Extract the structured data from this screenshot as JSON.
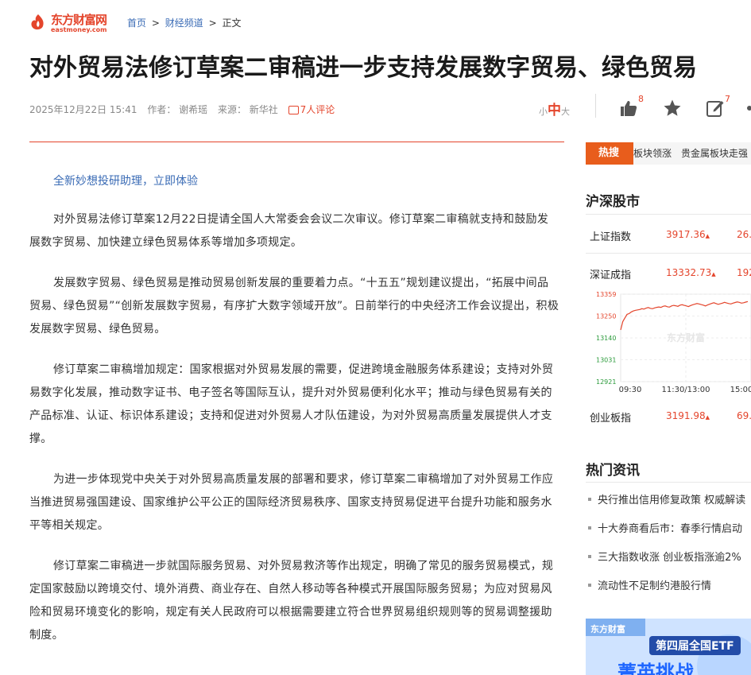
{
  "header": {
    "logo_cn": "东方财富网",
    "logo_en": "eastmoney.com",
    "breadcrumb": [
      "首页",
      "财经频道",
      "正文"
    ]
  },
  "article": {
    "title": "对外贸易法修订草案二审稿进一步支持发展数字贸易、绿色贸易",
    "date": "2025年12月22日 15:41",
    "author": "作者：  谢希瑶",
    "source": "来源：  新华社",
    "comments": "7人评论",
    "promo": "全新妙想投研助理，立即体验",
    "paragraphs": [
      "对外贸易法修订草案12月22日提请全国人大常委会会议二次审议。修订草案二审稿就支持和鼓励发展数字贸易、加快建立绿色贸易体系等增加多项规定。",
      "发展数字贸易、绿色贸易是推动贸易创新发展的重要着力点。“十五五”规划建议提出，“拓展中间品贸易、绿色贸易”“创新发展数字贸易，有序扩大数字领域开放”。日前举行的中央经济工作会议提出，积极发展数字贸易、绿色贸易。",
      "修订草案二审稿增加规定：国家根据对外贸易发展的需要，促进跨境金融服务体系建设；支持对外贸易数字化发展，推动数字证书、电子签名等国际互认，提升对外贸易便利化水平；推动与绿色贸易有关的产品标准、认证、标识体系建设；支持和促进对外贸易人才队伍建设，为对外贸易高质量发展提供人才支撑。",
      "为进一步体现党中央关于对外贸易高质量发展的部署和要求，修订草案二审稿增加了对外贸易工作应当推进贸易强国建设、国家维护公平公正的国际经济贸易秩序、国家支持贸易促进平台提升功能和服务水平等相关规定。",
      "修订草案二审稿进一步就国际服务贸易、对外贸易救济等作出规定，明确了常见的服务贸易模式，规定国家鼓励以跨境交付、境外消费、商业存在、自然人移动等各种模式开展国际服务贸易；为应对贸易风险和贸易环境变化的影响，规定有关人民政府可以根据需要建立符合世界贸易组织规则等的贸易调整援助制度。"
    ]
  },
  "toolbar": {
    "font_small": "小",
    "font_mid": "中",
    "font_large": "大",
    "like_count": "8",
    "edit_count": "7"
  },
  "sidebar": {
    "hot_label": "热搜",
    "hot_text": "板块领涨　贵金属板块走强",
    "market_title": "沪深股市",
    "indices": [
      {
        "name": "上证指数",
        "value": "3917.36",
        "change": "26."
      },
      {
        "name": "深证成指",
        "value": "13332.73",
        "change": "192."
      },
      {
        "name": "创业板指",
        "value": "3191.98",
        "change": "69."
      }
    ],
    "news_title": "热门资讯",
    "news": [
      "央行推出信用修复政策 权威解读",
      "十大券商看后市：春季行情启动",
      "三大指数收涨 创业板指涨逾2%",
      "流动性不足制约港股行情"
    ],
    "banner_logo": "东方财富",
    "banner_title": "第四届全国ETF",
    "banner_sub": "菁英挑战"
  },
  "chart_data": {
    "type": "line",
    "title": "",
    "y_ticks": [
      "13359",
      "13250",
      "13140",
      "13031",
      "12921"
    ],
    "x_ticks": [
      "09:30",
      "11:30/13:00",
      "15:00"
    ],
    "ylim": [
      12921,
      13359
    ],
    "watermark": "东方财富",
    "series": [
      {
        "values": [
          13180,
          13222,
          13240,
          13258,
          13262,
          13270,
          13275,
          13278,
          13280,
          13282,
          13286,
          13284,
          13289,
          13292,
          13288,
          13286,
          13290,
          13293,
          13295,
          13293,
          13298,
          13300,
          13296,
          13294,
          13300,
          13303,
          13301,
          13298,
          13304,
          13306,
          13303,
          13300,
          13297,
          13302,
          13306,
          13309,
          13312,
          13310,
          13307,
          13304,
          13300,
          13305,
          13309,
          13313,
          13316,
          13312,
          13308,
          13311,
          13314,
          13318,
          13315,
          13312,
          13310,
          13314,
          13317,
          13320,
          13318,
          13314,
          13316,
          13319,
          13322
        ]
      }
    ]
  }
}
